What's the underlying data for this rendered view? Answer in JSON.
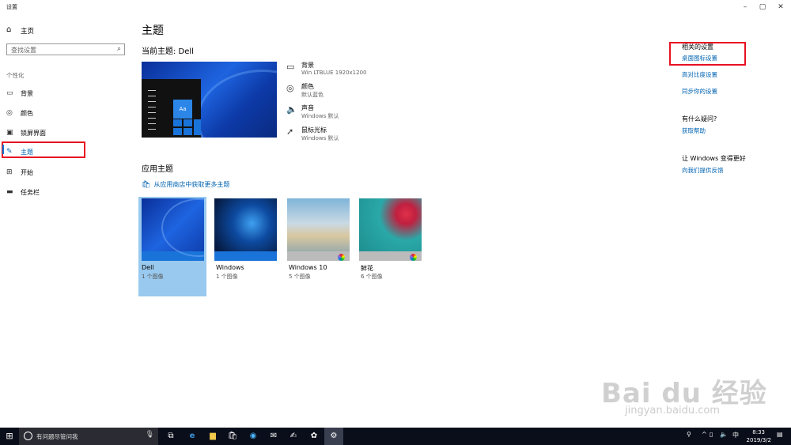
{
  "window": {
    "title": "设置",
    "controls": {
      "minimize": "–",
      "maximize": "▢",
      "close": "✕"
    }
  },
  "sidebar": {
    "home": {
      "icon": "home-icon",
      "label": "主页"
    },
    "search": {
      "placeholder": "查找设置",
      "icon": "search-icon"
    },
    "section": "个性化",
    "items": [
      {
        "icon": "picture-icon",
        "label": "背景"
      },
      {
        "icon": "palette-icon",
        "label": "颜色"
      },
      {
        "icon": "lock-screen-icon",
        "label": "锁屏界面"
      },
      {
        "icon": "brush-icon",
        "label": "主题",
        "active": true
      },
      {
        "icon": "start-icon",
        "label": "开始"
      },
      {
        "icon": "taskbar-icon",
        "label": "任务栏"
      }
    ]
  },
  "main": {
    "title": "主题",
    "current_theme": "当前主题: Dell",
    "preview": {
      "sample_text": "Aa"
    },
    "properties": [
      {
        "icon": "picture-icon",
        "name": "背景",
        "value": "Win LTBLUE 1920x1200"
      },
      {
        "icon": "palette-icon",
        "name": "颜色",
        "value": "默认蓝色"
      },
      {
        "icon": "speaker-icon",
        "name": "声音",
        "value": "Windows 默认"
      },
      {
        "icon": "cursor-icon",
        "name": "鼠标光标",
        "value": "Windows 默认"
      }
    ],
    "apply_title": "应用主题",
    "store_link": "从应用商店中获取更多主题",
    "themes": [
      {
        "name": "Dell",
        "count": "1 个图像",
        "selected": true
      },
      {
        "name": "Windows",
        "count": "1 个图像"
      },
      {
        "name": "Windows 10",
        "count": "5 个图像"
      },
      {
        "name": "鲜花",
        "count": "6 个图像"
      }
    ]
  },
  "related": {
    "heading": "相关的设置",
    "links": [
      "桌面图标设置",
      "高对比度设置",
      "同步你的设置"
    ],
    "help_heading": "有什么疑问?",
    "help_link": "获取帮助",
    "improve_heading": "让 Windows 变得更好",
    "improve_link": "向我们提供反馈"
  },
  "watermark": {
    "line1": "Bai du 经验",
    "line2": "jingyan.baidu.com"
  },
  "taskbar": {
    "search_placeholder": "有问题尽管问我",
    "tray": {
      "ime": "中",
      "time": "8:33",
      "date": "2019/3/2"
    }
  }
}
